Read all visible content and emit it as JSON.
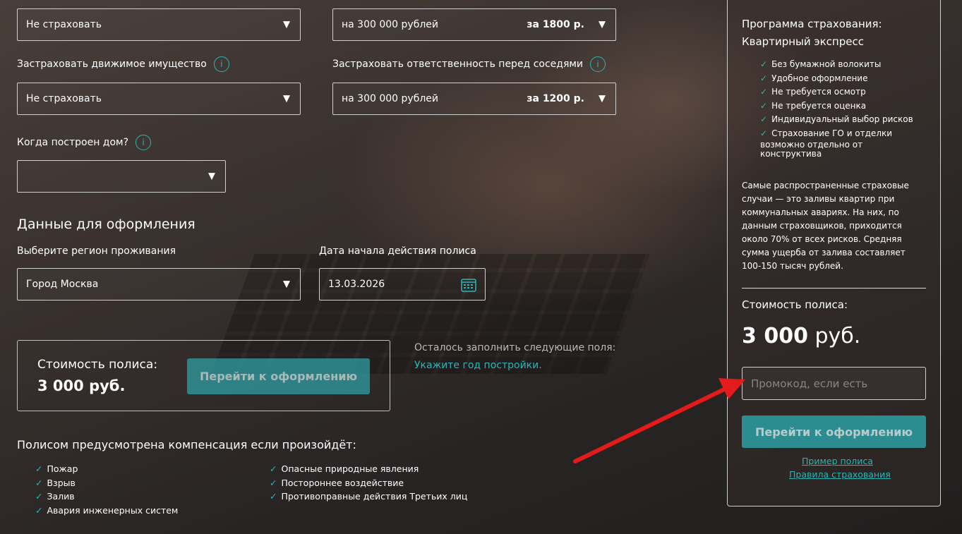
{
  "form": {
    "row1_left_value": "Не страховать",
    "row1_right_value": "на 300 000 рублей",
    "row1_right_price": "за 1800 р.",
    "movable_label": "Застраховать движимое имущество",
    "movable_value": "Не страховать",
    "liability_label": "Застраховать ответственность перед соседями",
    "liability_value": "на 300 000 рублей",
    "liability_price": "за 1200 р.",
    "house_year_label": "Когда построен дом?",
    "house_year_value": "",
    "info_icon": "i",
    "arrow_glyph": "▼"
  },
  "registration": {
    "title": "Данные для оформления",
    "region_label": "Выберите регион проживания",
    "region_value": "Город Москва",
    "date_label": "Дата начала действия полиса",
    "date_value": "13.03.2026"
  },
  "cost_box": {
    "label": "Стоимость полиса:",
    "value": "3 000 руб.",
    "button": "Перейти к оформлению"
  },
  "remaining": {
    "text": "Осталось заполнить следующие поля:",
    "link": "Укажите год постройки."
  },
  "compensation": {
    "title": "Полисом предусмотрена компенсация если произойдёт:",
    "col1": [
      "Пожар",
      "Взрыв",
      "Залив",
      "Авария инженерных систем"
    ],
    "col2": [
      "Опасные природные явления",
      "Постороннее воздействие",
      "Противоправные действия Третьих лиц"
    ]
  },
  "sidebar": {
    "title_line1": "Программа страхования:",
    "title_line2": "Квартирный экспресс",
    "features": [
      "Без бумажной волокиты",
      "Удобное оформление",
      "Не требуется осмотр",
      "Не требуется оценка",
      "Индивидуальный выбор рисков",
      "Страхование ГО и отделки"
    ],
    "feature_tail": "возможно отдельно от конструктива",
    "description": "Самые распространенные страховые случаи — это заливы квартир при коммунальных авариях. На них, по данным страховщиков, приходится около 70% от всех рисков. Средняя сумма ущерба от залива составляет 100-150 тысяч рублей.",
    "cost_label": "Стоимость полиса:",
    "cost_number": "3 000",
    "cost_currency": "руб.",
    "promo_placeholder": "Промокод, если есть",
    "button": "Перейти к оформлению",
    "link_example": "Пример полиса",
    "link_rules": "Правила страхования"
  },
  "colors": {
    "accent": "#2bb5b5",
    "button": "#2e9ea3",
    "arrow": "#e51a1a"
  },
  "icons": {
    "check": "✓",
    "calendar": "calendar-icon",
    "info": "info-icon"
  }
}
